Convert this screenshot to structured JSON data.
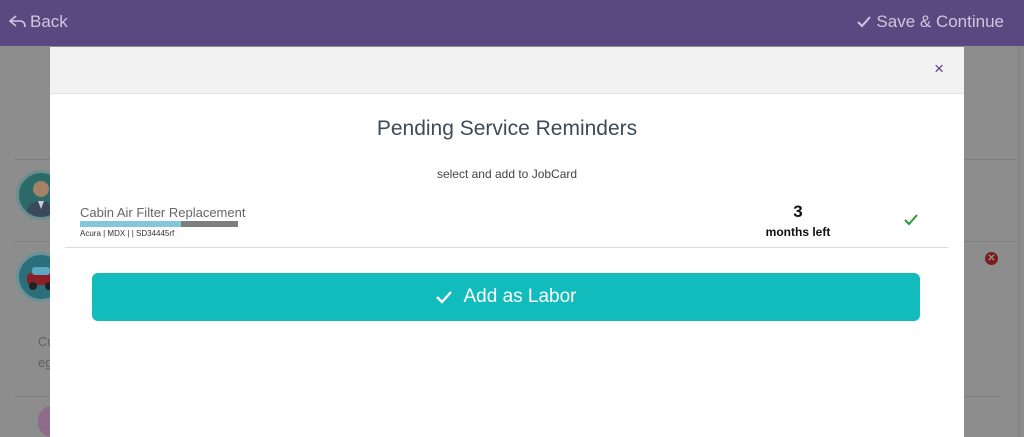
{
  "topbar": {
    "back_icon": "back-arrow-icon",
    "back_label": "Back",
    "save_icon": "check-icon",
    "save_label": "Save & Continue",
    "background": "#5a4880"
  },
  "background_page": {
    "partial_text_1": "Cu",
    "partial_text_2": "eg"
  },
  "modal": {
    "close_icon": "close-icon",
    "close_glyph": "×",
    "title": "Pending Service Reminders",
    "subtitle": "select and add to JobCard",
    "reminders": [
      {
        "name": "Cabin Air Filter Replacement",
        "meta": "Acura | MDX | | SD34445rf",
        "progress_fraction": 0.64,
        "count": "3",
        "unit": "months left",
        "selected": true
      }
    ],
    "add_button_label": "Add as Labor",
    "add_button_icon": "check-icon",
    "accent_color": "#12bcbc"
  }
}
